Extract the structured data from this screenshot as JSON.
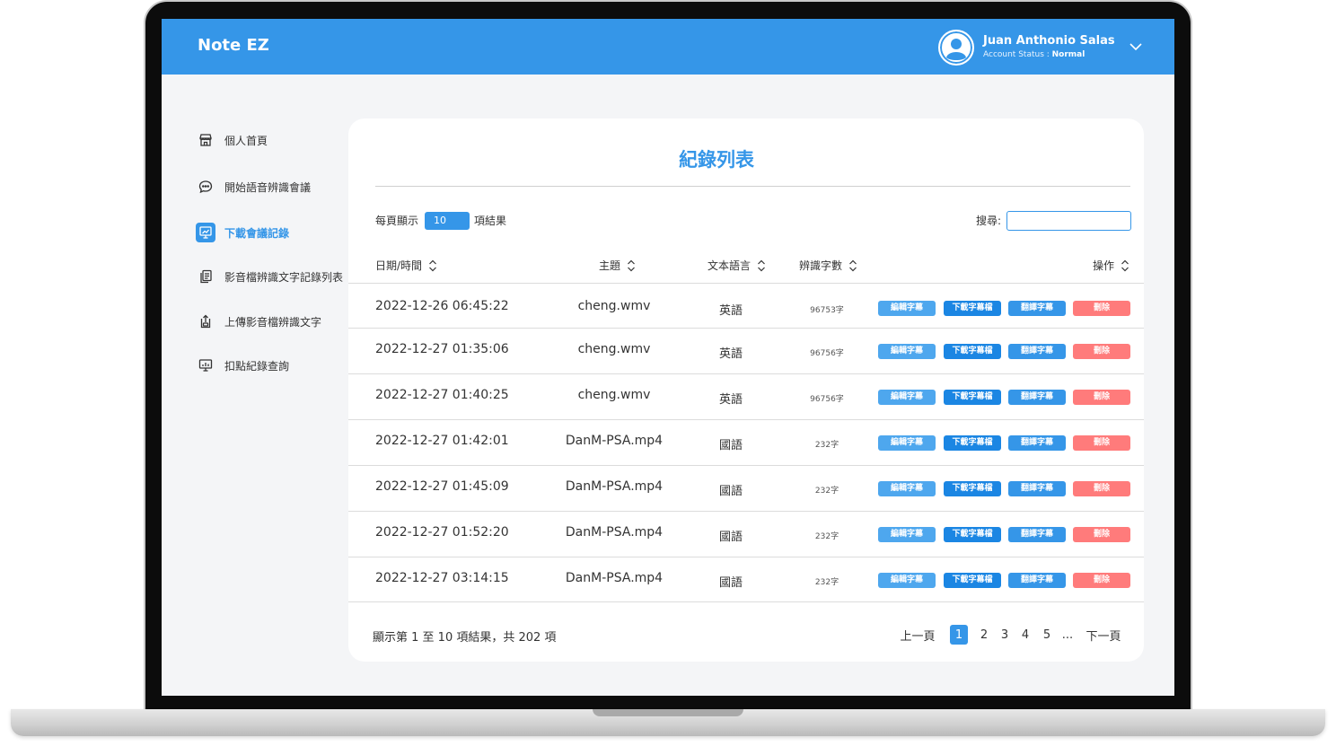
{
  "app": {
    "title": "Note EZ"
  },
  "user": {
    "name": "Juan Anthonio Salas",
    "status_label": "Account Status : ",
    "status_value": "Normal"
  },
  "sidebar": {
    "items": [
      {
        "label": "個人首頁",
        "icon": "storefront-icon",
        "active": false
      },
      {
        "label": "開始語音辨識會議",
        "icon": "chat-bubble-icon",
        "active": false
      },
      {
        "label": "下載會議記錄",
        "icon": "presentation-chart-icon",
        "active": true
      },
      {
        "label": "影音檔辨識文字記錄列表",
        "icon": "documents-icon",
        "active": false
      },
      {
        "label": "上傳影音檔辨識文字",
        "icon": "upload-file-icon",
        "active": false
      },
      {
        "label": "扣點紀錄查詢",
        "icon": "presentation-board-icon",
        "active": false
      }
    ]
  },
  "main": {
    "title": "紀錄列表",
    "page_len_prefix": "每頁顯示",
    "page_len_value": "10",
    "page_len_suffix": "項結果",
    "search_label": "搜尋:",
    "search_value": "",
    "columns": {
      "date": "日期/時間",
      "topic": "主題",
      "lang": "文本語言",
      "count": "辨識字數",
      "actions": "操作"
    },
    "rows": [
      {
        "date": "2022-12-26 06:45:22",
        "topic": "cheng.wmv",
        "lang": "英語",
        "count": "96753字"
      },
      {
        "date": "2022-12-27 01:35:06",
        "topic": "cheng.wmv",
        "lang": "英語",
        "count": "96756字"
      },
      {
        "date": "2022-12-27 01:40:25",
        "topic": "cheng.wmv",
        "lang": "英語",
        "count": "96756字"
      },
      {
        "date": "2022-12-27 01:42:01",
        "topic": "DanM-PSA.mp4",
        "lang": "國語",
        "count": "232字"
      },
      {
        "date": "2022-12-27 01:45:09",
        "topic": "DanM-PSA.mp4",
        "lang": "國語",
        "count": "232字"
      },
      {
        "date": "2022-12-27 01:52:20",
        "topic": "DanM-PSA.mp4",
        "lang": "國語",
        "count": "232字"
      },
      {
        "date": "2022-12-27 03:14:15",
        "topic": "DanM-PSA.mp4",
        "lang": "國語",
        "count": "232字"
      }
    ],
    "actions": {
      "edit": "編輯字幕",
      "download": "下載字幕檔",
      "translate": "翻譯字幕",
      "delete": "刪除"
    },
    "summary": "顯示第 1 至 10 項結果，共 202 項",
    "pagination": {
      "prev": "上一頁",
      "pages": [
        "1",
        "2",
        "3",
        "4",
        "5"
      ],
      "current": "1",
      "ellipsis": "...",
      "next": "下一頁"
    }
  },
  "colors": {
    "primary": "#3596e8",
    "danger": "#ff7b7b",
    "background": "#f4f5f7"
  }
}
